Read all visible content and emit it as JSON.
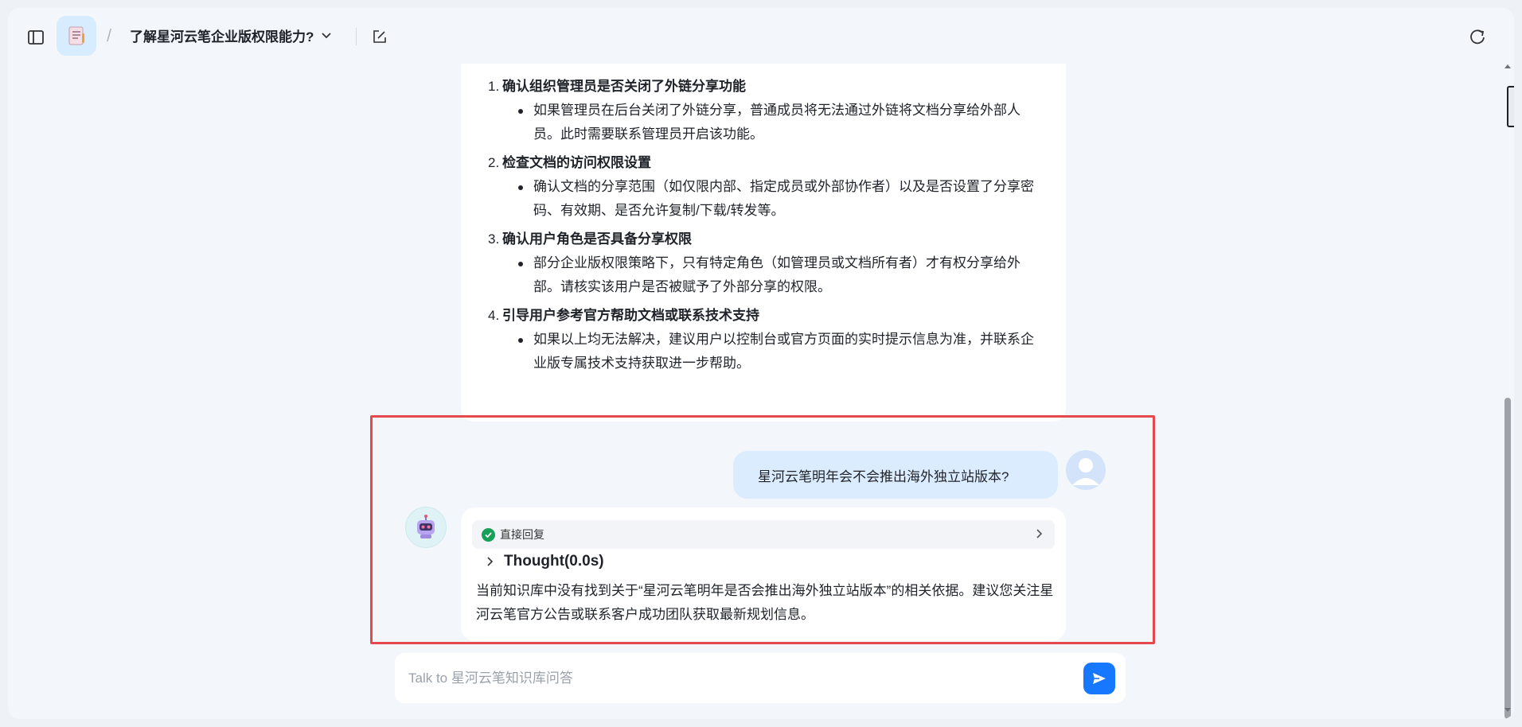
{
  "header": {
    "title": "了解星河云笔企业版权限能力?",
    "separator": "/"
  },
  "previous_answer": {
    "items": [
      {
        "number": "1.",
        "heading": "确认组织管理员是否关闭了外链分享功能",
        "bullet": "如果管理员在后台关闭了外链分享，普通成员将无法通过外链将文档分享给外部人员。此时需要联系管理员开启该功能。"
      },
      {
        "number": "2.",
        "heading": "检查文档的访问权限设置",
        "bullet": "确认文档的分享范围（如仅限内部、指定成员或外部协作者）以及是否设置了分享密码、有效期、是否允许复制/下载/转发等。"
      },
      {
        "number": "3.",
        "heading": "确认用户角色是否具备分享权限",
        "bullet": "部分企业版权限策略下，只有特定角色（如管理员或文档所有者）才有权分享给外部。请核实该用户是否被赋予了外部分享的权限。"
      },
      {
        "number": "4.",
        "heading": "引导用户参考官方帮助文档或联系技术支持",
        "bullet": "如果以上均无法解决，建议用户以控制台或官方页面的实时提示信息为准，并联系企业版专属技术支持获取进一步帮助。"
      }
    ]
  },
  "user_message": {
    "text": "星河云笔明年会不会推出海外独立站版本?"
  },
  "bot_message": {
    "source_label": "直接回复",
    "thought_label": "Thought(0.0s)",
    "answer": "当前知识库中没有找到关于“星河云笔明年是否会推出海外独立站版本”的相关依据。建议您关注星河云笔官方公告或联系客户成功团队获取最新规划信息。"
  },
  "input": {
    "placeholder": "Talk to 星河云笔知识库问答",
    "value": ""
  },
  "colors": {
    "accent": "#1677ff",
    "highlight_border": "#e5484d",
    "user_bubble": "#dcecff",
    "success": "#18a058"
  }
}
